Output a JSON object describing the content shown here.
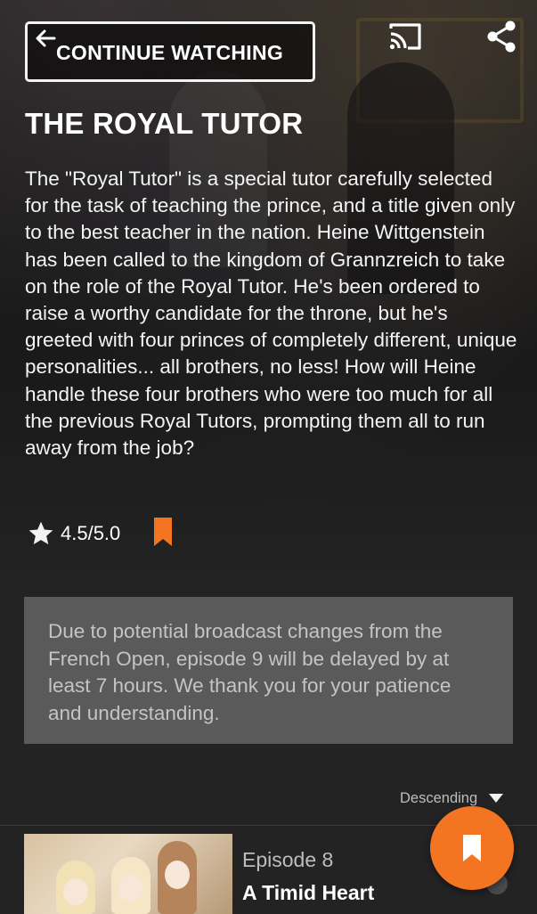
{
  "header": {
    "continue_label": "CONTINUE WATCHING",
    "back_icon": "arrow-back-icon",
    "cast_icon": "cast-icon",
    "share_icon": "share-icon"
  },
  "show": {
    "title": "THE ROYAL TUTOR",
    "description": "The \"Royal Tutor\" is a special tutor carefully selected for the task of teaching the prince, and a title given only to the best teacher in the nation. Heine Wittgenstein has been called to the kingdom of Grannzreich to take on the role of the Royal Tutor. He's been ordered to raise a worthy candidate for the throne, but he's greeted with four princes of completely different, unique personalities... all brothers, no less! How will Heine handle these four brothers who were too much for all the previous Royal Tutors, prompting them all to run away from the job?",
    "rating": "4.5/5.0"
  },
  "notice": {
    "text": "Due to potential broadcast changes from the French Open, episode 9 will be delayed by at least 7 hours. We thank you for your patience and understanding."
  },
  "sort": {
    "label": "Descending"
  },
  "episodes": [
    {
      "number": "Episode 8",
      "title": "A Timid Heart"
    }
  ],
  "colors": {
    "accent": "#f47521",
    "background": "#232323",
    "notice_bg": "#5a5a5a"
  }
}
